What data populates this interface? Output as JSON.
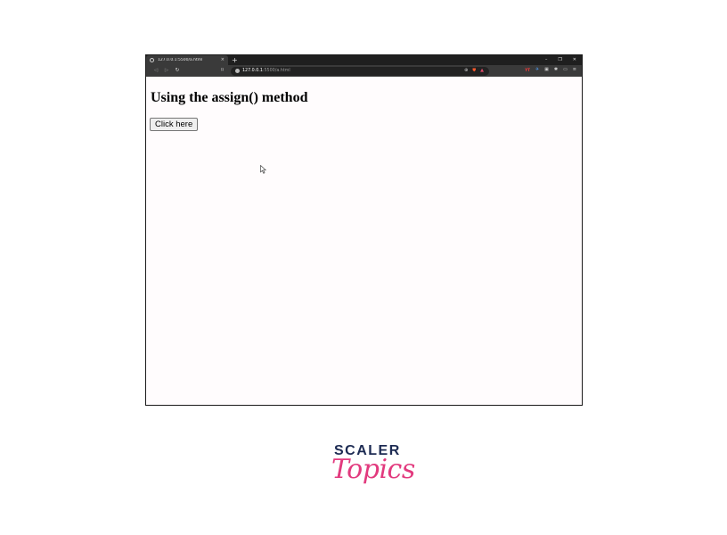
{
  "browser": {
    "tab": {
      "title": "127.0.0.1:5500/a.html",
      "close": "×"
    },
    "new_tab": "+",
    "window_controls": {
      "minimize": "–",
      "restore": "❐",
      "close": "✕"
    },
    "nav": {
      "back": "◁",
      "forward": "▷",
      "reload": "↻",
      "bookmark": "⌑"
    },
    "address": {
      "host": "127.0.0.1",
      "path": ":5500/a.html"
    },
    "omnibox_icons": {
      "zoom": "⊕",
      "brave": "⛊",
      "rewards": "▲"
    },
    "extensions": {
      "yt": "YT",
      "vpn": "✈",
      "doc": "▣",
      "puzzle": "✱",
      "media": "▭",
      "menu": "≡"
    }
  },
  "page": {
    "heading": "Using the assign() method",
    "button_label": "Click here"
  },
  "logo": {
    "top": "SCALER",
    "bottom": "Topics"
  },
  "colors": {
    "tab_bar": "#1f1f1f",
    "toolbar": "#3a3a3a",
    "page_bg": "#fffcfd",
    "logo_navy": "#1d2b53",
    "logo_pink": "#e23a7e"
  }
}
